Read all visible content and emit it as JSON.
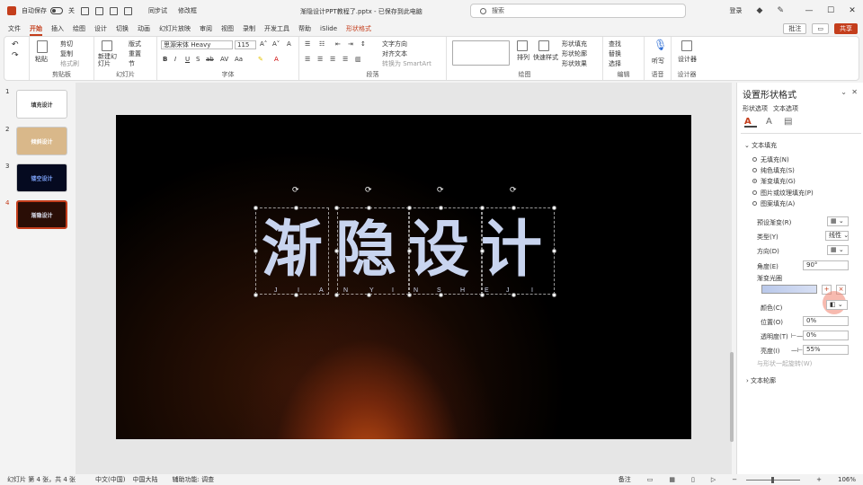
{
  "titlebar": {
    "autosave_label": "自动保存",
    "autosave_state": "关",
    "quick_label": "同步试",
    "quick_label2": "修改框",
    "doc_title": "渐隐设计PPT教程了.pptx - 已保存到此电脑",
    "search_placeholder": "搜索",
    "user": "登录"
  },
  "ribbon": {
    "tabs": [
      "文件",
      "开始",
      "插入",
      "绘图",
      "设计",
      "切换",
      "动画",
      "幻灯片放映",
      "审阅",
      "视图",
      "录制",
      "开发工具",
      "帮助",
      "iSlide",
      "形状格式"
    ],
    "comment_btn": "批注",
    "share_btn": "共享",
    "clipboard": {
      "paste": "粘贴",
      "cut": "剪切",
      "copy": "复制",
      "format_painter": "格式刷",
      "label": "剪贴板"
    },
    "slides": {
      "new_slide": "新建幻灯片",
      "layout": "版式",
      "reset": "重置",
      "section": "节",
      "label": "幻灯片"
    },
    "font": {
      "name": "思源宋体 Heavy",
      "size": "115",
      "label": "字体"
    },
    "paragraph": {
      "text_dir": "文字方向",
      "align_text": "对齐文本",
      "smartart": "转换为 SmartArt",
      "label": "段落"
    },
    "drawing": {
      "arrange": "排列",
      "quick_styles": "快速样式",
      "fill": "形状填充",
      "outline": "形状轮廓",
      "effects": "形状效果",
      "label": "绘图"
    },
    "editing": {
      "find": "查找",
      "replace": "替换",
      "select": "选择",
      "label": "编辑"
    },
    "voice": {
      "dictate": "听写",
      "label": "语音"
    },
    "designer": {
      "designer": "设计器",
      "label": "设计器"
    }
  },
  "thumbnails": [
    {
      "num": "1",
      "text": "填充设计",
      "bg": "#ffffff",
      "fg": "#333333"
    },
    {
      "num": "2",
      "text": "倾斜设计",
      "bg": "#d9b88a",
      "fg": "#ffffff"
    },
    {
      "num": "3",
      "text": "镂空设计",
      "bg": "#050a20",
      "fg": "#7fa6ff"
    },
    {
      "num": "4",
      "text": "渐隐设计",
      "bg": "#2a0e06",
      "fg": "#e0e6f5"
    }
  ],
  "slide": {
    "chars": [
      "渐",
      "隐",
      "设",
      "计"
    ],
    "pinyin": [
      "J",
      "I",
      "A",
      "N",
      "Y",
      "I",
      "N",
      "S",
      "H",
      "E",
      "J",
      "I"
    ]
  },
  "pane": {
    "title": "设置形状格式",
    "tab_shape": "形状选项",
    "tab_text": "文本选项",
    "section_fill": "文本填充",
    "options": [
      "无填充(N)",
      "纯色填充(S)",
      "渐变填充(G)",
      "图片或纹理填充(P)",
      "图案填充(A)"
    ],
    "selected_option": 2,
    "preset": "预设渐变(R)",
    "type_label": "类型(Y)",
    "type_value": "线性",
    "direction_label": "方向(D)",
    "angle_label": "角度(E)",
    "angle_value": "90°",
    "stops_label": "渐变光圈",
    "color_label": "颜色(C)",
    "position_label": "位置(O)",
    "position_value": "0%",
    "transparency_label": "透明度(T)",
    "transparency_value": "0%",
    "brightness_label": "亮度(I)",
    "brightness_value": "55%",
    "rotate_with_shape": "与形状一起旋转(W)",
    "section_outline": "文本轮廓"
  },
  "status": {
    "slide_info": "幻灯片 第 4 张，共 4 张",
    "language": "中文(中国)",
    "accessibility": "中国大陆",
    "accessibility2": "辅助功能: 调查",
    "notes": "备注",
    "zoom": "106%"
  }
}
